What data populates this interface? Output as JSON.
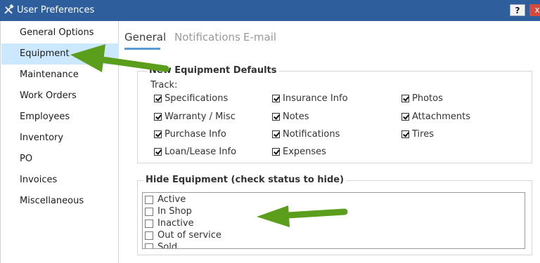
{
  "window": {
    "title": "User Preferences",
    "help_label": "?",
    "close_label": "x",
    "icon": "tools-icon"
  },
  "sidebar": {
    "items": [
      {
        "label": "General Options",
        "selected": false
      },
      {
        "label": "Equipment",
        "selected": true
      },
      {
        "label": "Maintenance",
        "selected": false
      },
      {
        "label": "Work Orders",
        "selected": false
      },
      {
        "label": "Employees",
        "selected": false
      },
      {
        "label": "Inventory",
        "selected": false
      },
      {
        "label": "PO",
        "selected": false
      },
      {
        "label": "Invoices",
        "selected": false
      },
      {
        "label": "Miscellaneous",
        "selected": false
      }
    ]
  },
  "tabs": [
    {
      "label": "General",
      "active": true
    },
    {
      "label": "Notifications",
      "active": false
    },
    {
      "label": "E-mail",
      "active": false
    }
  ],
  "equipment_defaults": {
    "title": "New Equipment Defaults",
    "track_label": "Track:",
    "options": [
      {
        "label": "Specifications",
        "checked": true
      },
      {
        "label": "Warranty / Misc",
        "checked": true
      },
      {
        "label": "Purchase Info",
        "checked": true
      },
      {
        "label": "Loan/Lease Info",
        "checked": true
      },
      {
        "label": "Insurance Info",
        "checked": true
      },
      {
        "label": "Notes",
        "checked": true
      },
      {
        "label": "Notifications",
        "checked": true
      },
      {
        "label": "Expenses",
        "checked": true
      },
      {
        "label": "Photos",
        "checked": true
      },
      {
        "label": "Attachments",
        "checked": true
      },
      {
        "label": "Tires",
        "checked": true
      }
    ]
  },
  "hide_equipment": {
    "title": "Hide Equipment (check status to hide)",
    "statuses": [
      {
        "label": "Active",
        "checked": false
      },
      {
        "label": "In Shop",
        "checked": false
      },
      {
        "label": "Inactive",
        "checked": false
      },
      {
        "label": "Out of service",
        "checked": false
      },
      {
        "label": "Sold",
        "checked": false
      }
    ]
  },
  "annotations": {
    "arrow_color": "#5a9e1c"
  }
}
